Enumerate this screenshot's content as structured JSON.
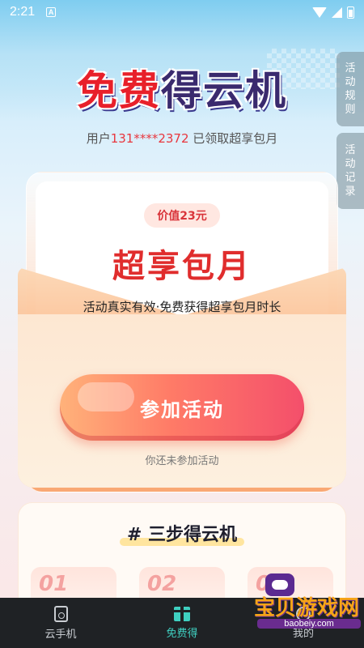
{
  "status_bar": {
    "time": "2:21",
    "notification": "A"
  },
  "header": {
    "title_highlight": "免费",
    "title_rest": "得云机",
    "subtitle_prefix": "用户",
    "phone": "131****2372",
    "subtitle_suffix": "已领取超享包月"
  },
  "side_tabs": [
    {
      "label": [
        "活",
        "动",
        "规",
        "则"
      ]
    },
    {
      "label": [
        "活",
        "动",
        "记",
        "录"
      ]
    }
  ],
  "offer": {
    "price_badge": "价值23元",
    "plan_name": "超享包月",
    "description": "活动真实有效·免费获得超享包月时长",
    "join_button": "参加活动",
    "join_status": "你还未参加活动"
  },
  "steps": {
    "title": "# 三步得云机",
    "items": [
      "01",
      "02",
      "03"
    ]
  },
  "bottom_nav": {
    "items": [
      {
        "label": "云手机",
        "icon": "phone-icon",
        "active": false
      },
      {
        "label": "免费得",
        "icon": "gift-icon",
        "active": true
      },
      {
        "label": "我的",
        "icon": "profile-icon",
        "active": false
      }
    ]
  },
  "watermark": {
    "text": "宝贝游戏网",
    "url": "baobeiy.com"
  },
  "colors": {
    "accent_red": "#e02d2d",
    "active_tab": "#3fd0c1",
    "navbar_bg": "#1f2225"
  }
}
